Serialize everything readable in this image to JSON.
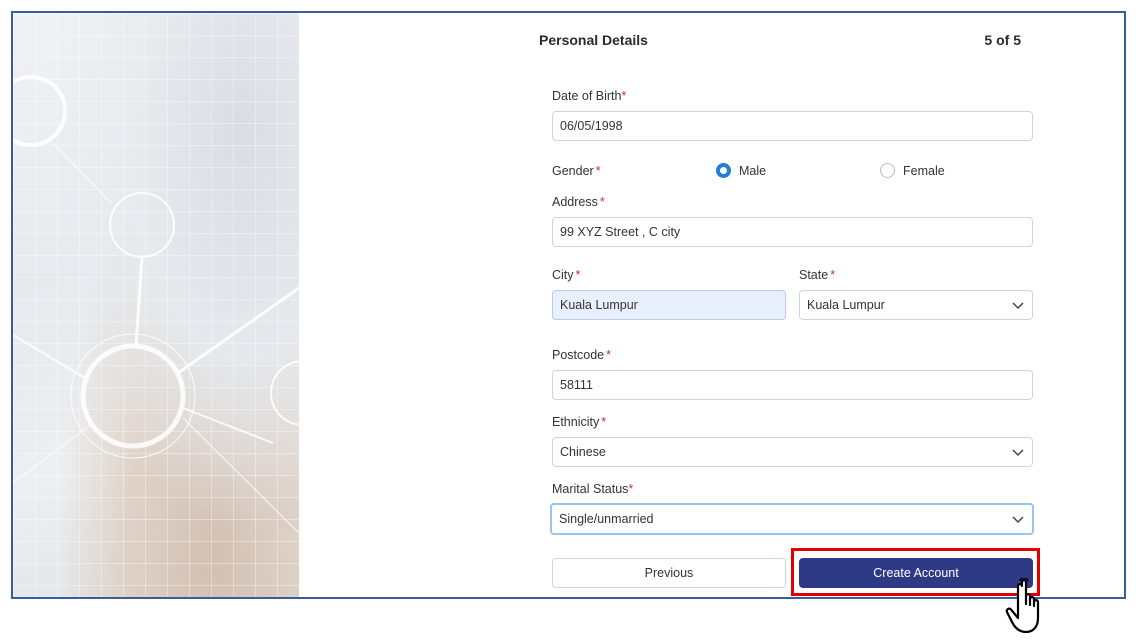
{
  "form": {
    "title": "Personal Details",
    "step": "5 of 5",
    "required_marker": "*",
    "dob": {
      "label": "Date of Birth",
      "value": "06/05/1998"
    },
    "gender": {
      "label": "Gender",
      "options": [
        "Male",
        "Female"
      ],
      "selected": "Male"
    },
    "address": {
      "label": "Address",
      "value": "99 XYZ Street , C city"
    },
    "city": {
      "label": "City",
      "value": "Kuala Lumpur"
    },
    "state": {
      "label": "State",
      "value": "Kuala Lumpur"
    },
    "postcode": {
      "label": "Postcode",
      "value": "58111"
    },
    "ethnicity": {
      "label": "Ethnicity",
      "value": "Chinese"
    },
    "marital": {
      "label": "Marital Status",
      "value": "Single/unmarried"
    }
  },
  "buttons": {
    "previous": "Previous",
    "create": "Create Account"
  },
  "icons": {
    "select": "chevron-down-icon",
    "cursor": "hand-pointer-icon"
  },
  "colors": {
    "primary": "#2f3a86",
    "required": "#d0312d",
    "radio_selected": "#1f7fd6",
    "highlight": "#e00000",
    "frame_border": "#3a5ba0"
  }
}
